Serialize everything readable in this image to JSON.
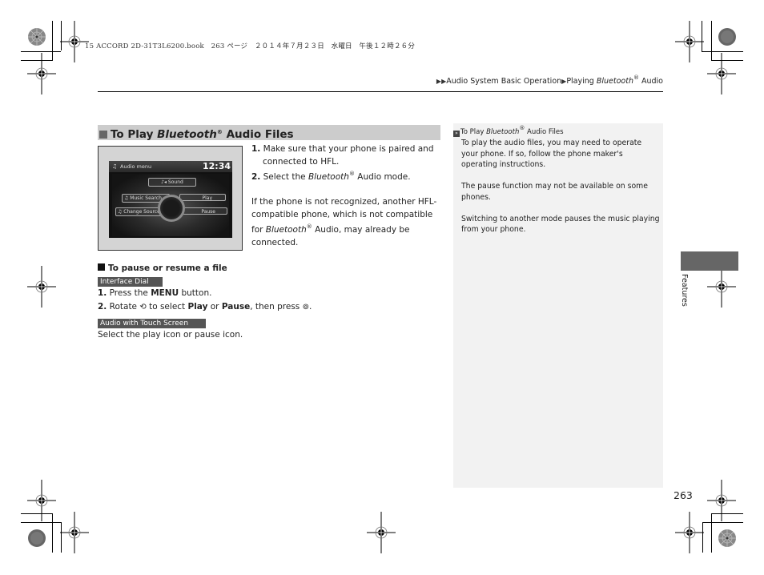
{
  "file_header": "15 ACCORD 2D-31T3L6200.book　263 ページ　２０１４年７月２３日　水曜日　午後１２時２６分",
  "breadcrumb": {
    "arrows": "▶▶",
    "section": "Audio System Basic Operation",
    "sep": "▶",
    "page_prefix": "Playing ",
    "page_italic": "Bluetooth",
    "page_reg": "®",
    "page_suffix": " Audio"
  },
  "section": {
    "title_prefix": "To Play ",
    "title_italic": "Bluetooth",
    "title_reg": "®",
    "title_suffix": " Audio Files"
  },
  "screen": {
    "title": "Audio menu",
    "clock": "12:34",
    "buttons": {
      "sound": "Sound",
      "music_search": "Music Search",
      "play": "Play",
      "change_source": "Change Source",
      "pause": "Pause"
    }
  },
  "steps": {
    "step1_num": "1.",
    "step1_text": "Make sure that your phone is paired and connected to HFL.",
    "step2_num": "2.",
    "step2_prefix": "Select the ",
    "step2_italic": "Bluetooth",
    "step2_reg": "®",
    "step2_suffix": " Audio mode.",
    "note_prefix": "If the phone is not recognized, another HFL-compatible phone, which is not compatible for ",
    "note_italic": "Bluetooth",
    "note_reg": "®",
    "note_suffix": " Audio, may already be connected."
  },
  "pause_section": {
    "title": "To pause or resume a file",
    "tag_dial": "Interface Dial",
    "dial_step1_num": "1.",
    "dial_step1_prefix": "Press the ",
    "dial_step1_bold": "MENU",
    "dial_step1_suffix": " button.",
    "dial_step2_num": "2.",
    "dial_step2_prefix": "Rotate ",
    "dial_step2_mid1": " to select ",
    "dial_step2_bold1": "Play",
    "dial_step2_or": " or ",
    "dial_step2_bold2": "Pause",
    "dial_step2_mid2": ", then press ",
    "dial_step2_end": ".",
    "tag_touch": "Audio with Touch Screen",
    "touch_text": "Select the play icon or pause icon."
  },
  "sidebar": {
    "ref_prefix": "To Play ",
    "ref_italic": "Bluetooth",
    "ref_reg": "®",
    "ref_suffix": " Audio Files",
    "notes": [
      "To play the audio files, you may need to operate your phone. If so, follow the phone maker's operating instructions.",
      "The pause function may not be available on some phones.",
      "Switching to another mode pauses the music playing from your phone."
    ]
  },
  "side_tab": "Features",
  "page_number": "263",
  "colors": {
    "section_head_bg": "#cccccc",
    "tag_bg": "#555555",
    "sidebar_bg": "#f2f2f2",
    "tab_block": "#666666"
  }
}
